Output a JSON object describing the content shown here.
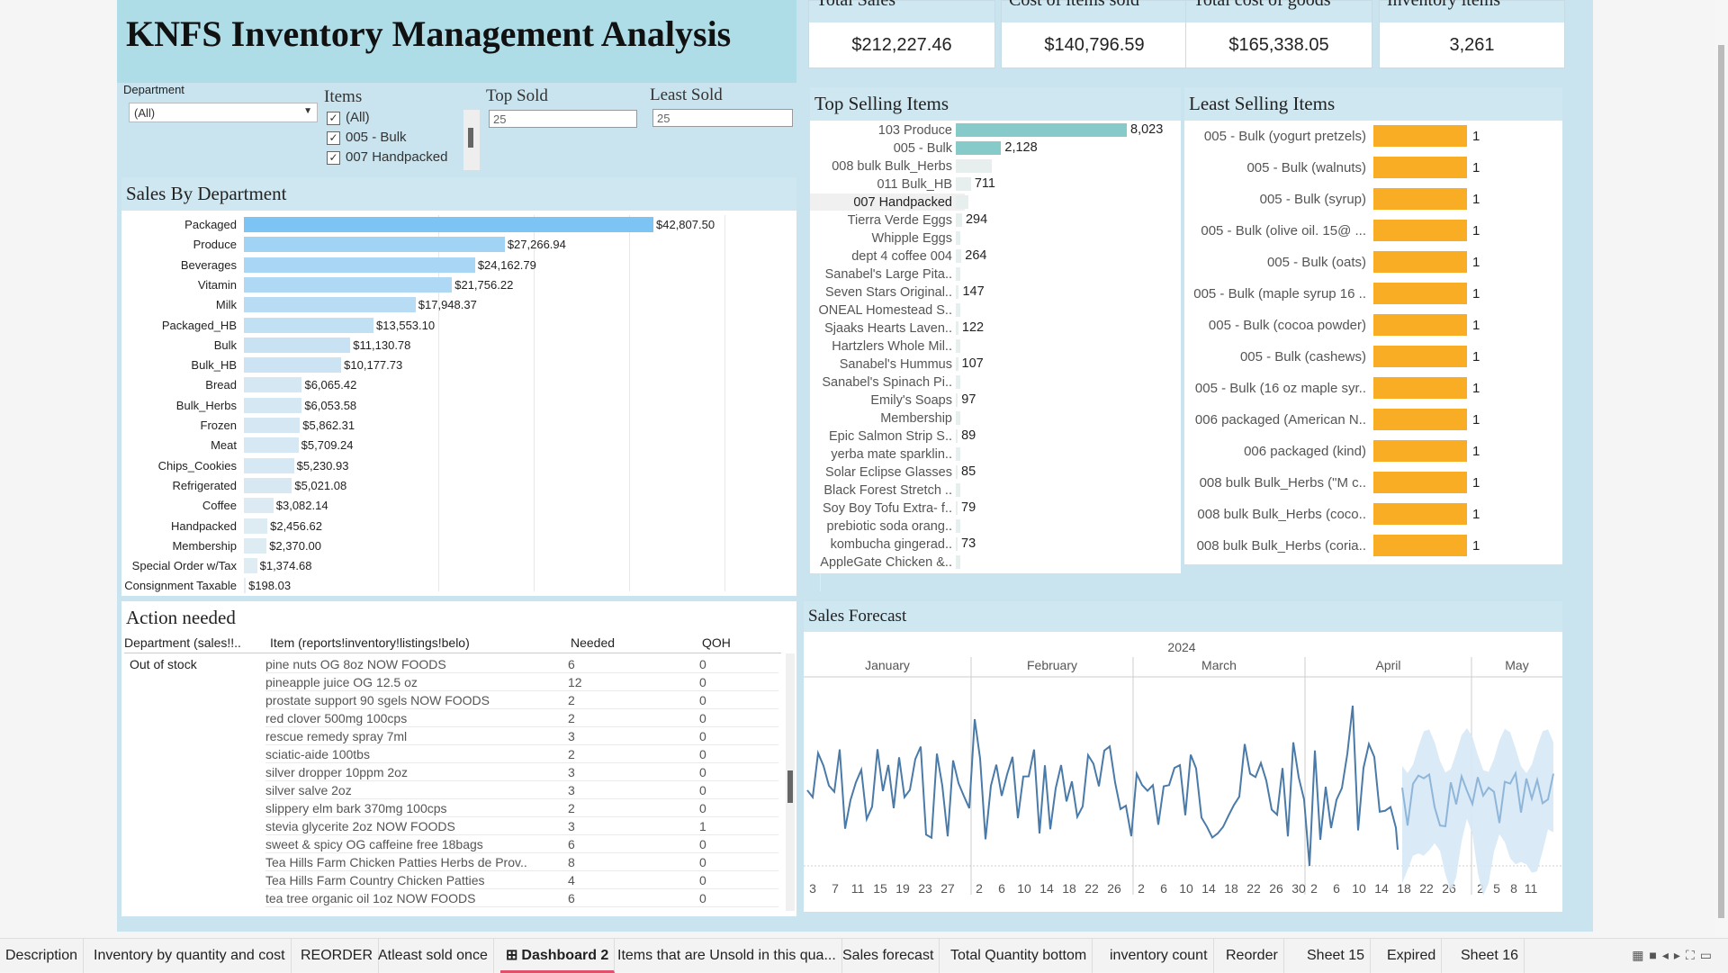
{
  "header": {
    "title": "KNFS Inventory Management Analysis"
  },
  "kpis": [
    {
      "label": "Total Sales",
      "value": "$212,227.46"
    },
    {
      "label": "Cost of items sold",
      "value": "$140,796.59"
    },
    {
      "label": "Total cost of goods",
      "value": "$165,338.05"
    },
    {
      "label": "Inventory items",
      "value": "3,261"
    }
  ],
  "filters": {
    "department_label": "Department",
    "department_value": "(All)",
    "items_label": "Items",
    "items_options": [
      "(All)",
      "005 - Bulk",
      "007 Handpacked"
    ],
    "top_sold_label": "Top Sold",
    "top_sold_value": "25",
    "least_sold_label": "Least Sold",
    "least_sold_value": "25"
  },
  "sales_by_department": {
    "title": "Sales By Department",
    "chart_data": {
      "type": "bar",
      "categories": [
        "Packaged",
        "Produce",
        "Beverages",
        "Vitamin",
        "Milk",
        "Packaged_HB",
        "Bulk",
        "Bulk_HB",
        "Bread",
        "Bulk_Herbs",
        "Frozen",
        "Meat",
        "Chips_Cookies",
        "Refrigerated",
        "Coffee",
        "Handpacked",
        "Membership",
        "Special Order w/Tax",
        "Consignment Taxable"
      ],
      "values": [
        42807.5,
        27266.94,
        24162.79,
        21756.22,
        17948.37,
        13553.1,
        11130.78,
        10177.73,
        6065.42,
        6053.58,
        5862.31,
        5709.24,
        5230.93,
        5021.08,
        3082.14,
        2456.62,
        2370.0,
        1374.68,
        198.03
      ],
      "labels": [
        "$42,807.50",
        "$27,266.94",
        "$24,162.79",
        "$21,756.22",
        "$17,948.37",
        "$13,553.10",
        "$11,130.78",
        "$10,177.73",
        "$6,065.42",
        "$6,053.58",
        "$5,862.31",
        "$5,709.24",
        "$5,230.93",
        "$5,021.08",
        "$3,082.14",
        "$2,456.62",
        "$2,370.00",
        "$1,374.68",
        "$198.03"
      ]
    }
  },
  "top_selling": {
    "title": "Top Selling Items",
    "chart_data": {
      "type": "bar",
      "categories": [
        "103 Produce",
        "005 - Bulk",
        "008 bulk Bulk_Herbs",
        "011 Bulk_HB",
        "007 Handpacked",
        "Tierra Verde Eggs",
        "Whipple Eggs",
        "dept 4 coffee 004",
        "Sanabel's Large Pita..",
        "Seven Stars Original..",
        "ONEAL Homestead S..",
        "Sjaaks  Hearts Laven..",
        "Hartzlers Whole Mil..",
        "Sanabel's Hummus",
        "Sanabel's Spinach Pi..",
        "Emily's Soaps",
        "Membership",
        "Epic Salmon Strip S..",
        "yerba mate sparklin..",
        "Solar Eclipse Glasses",
        "Black Forest Stretch ..",
        "Soy Boy Tofu Extra- f..",
        "prebiotic soda orang..",
        "kombucha gingerad..",
        "AppleGate Chicken &.."
      ],
      "values": [
        8023,
        2128,
        null,
        711,
        null,
        294,
        null,
        264,
        null,
        147,
        null,
        122,
        null,
        107,
        null,
        97,
        null,
        89,
        null,
        85,
        null,
        79,
        null,
        73,
        null
      ],
      "labels": [
        "8,023",
        "2,128",
        "",
        "711",
        "",
        "294",
        "",
        "264",
        "",
        "147",
        "",
        "122",
        "",
        "107",
        "",
        "97",
        "",
        "89",
        "",
        "85",
        "",
        "79",
        "",
        "73",
        ""
      ]
    }
  },
  "least_selling": {
    "title": "Least Selling Items",
    "chart_data": {
      "type": "bar",
      "categories": [
        "005 - Bulk (yogurt pretzels)",
        "005 - Bulk (walnuts)",
        "005 - Bulk (syrup)",
        "005 - Bulk (olive oil.  15@ ...",
        "005 - Bulk (oats)",
        "005 - Bulk (maple syrup 16 ..",
        "005 - Bulk (cocoa powder)",
        "005 - Bulk (cashews)",
        "005 - Bulk (16 oz maple syr..",
        "006 packaged (American N..",
        "006 packaged (kind)",
        "008 bulk Bulk_Herbs (\"M c..",
        "008 bulk Bulk_Herbs (coco..",
        "008 bulk Bulk_Herbs (coria.."
      ],
      "values": [
        1,
        1,
        1,
        1,
        1,
        1,
        1,
        1,
        1,
        1,
        1,
        1,
        1,
        1
      ],
      "labels": [
        "1",
        "1",
        "1",
        "1",
        "1",
        "1",
        "1",
        "1",
        "1",
        "1",
        "1",
        "1",
        "1",
        "1"
      ]
    }
  },
  "action_needed": {
    "title": "Action needed",
    "columns": [
      "Department (sales!!..",
      "Item (reports!inventory!listings!belo)",
      "Needed",
      "QOH"
    ],
    "group": "Out of stock",
    "rows": [
      [
        "pine nuts OG 8oz NOW FOODS",
        "6",
        "0"
      ],
      [
        "pineapple juice OG 12.5 oz",
        "12",
        "0"
      ],
      [
        "prostate support 90 sgels NOW FOODS",
        "2",
        "0"
      ],
      [
        "red clover 500mg 100cps",
        "2",
        "0"
      ],
      [
        "rescue remedy spray 7ml",
        "3",
        "0"
      ],
      [
        "sciatic-aide 100tbs",
        "2",
        "0"
      ],
      [
        "silver dropper 10ppm 2oz",
        "3",
        "0"
      ],
      [
        "silver salve 2oz",
        "3",
        "0"
      ],
      [
        "slippery elm bark 370mg 100cps",
        "2",
        "0"
      ],
      [
        "stevia glycerite 2oz NOW FOODS",
        "3",
        "1"
      ],
      [
        "sweet & spicy OG caffeine free 18bags",
        "6",
        "0"
      ],
      [
        "Tea Hills Farm Chicken Patties Herbs de Prov..",
        "8",
        "0"
      ],
      [
        "Tea Hills Farm Country Chicken Patties",
        "4",
        "0"
      ],
      [
        "tea tree organic oil 1oz NOW FOODS",
        "6",
        "0"
      ]
    ]
  },
  "forecast": {
    "title": "Sales Forecast",
    "year": "2024",
    "months": [
      "January",
      "February",
      "March",
      "April",
      "May"
    ],
    "days": {
      "January": [
        "3",
        "7",
        "11",
        "15",
        "19",
        "23",
        "27"
      ],
      "February": [
        "2",
        "6",
        "10",
        "14",
        "18",
        "22",
        "26"
      ],
      "March": [
        "2",
        "6",
        "10",
        "14",
        "18",
        "22",
        "26",
        "30"
      ],
      "April": [
        "2",
        "6",
        "10",
        "14",
        "18",
        "22",
        "26"
      ],
      "May": [
        "2",
        "5",
        "8",
        "11"
      ]
    }
  },
  "tabs": [
    "Description",
    "Inventory by quantity and cost",
    "REORDER",
    "Atleast sold once",
    "Dashboard 2",
    "Items that are Unsold in this qua...",
    "Sales forecast",
    "Total Quantity  bottom",
    "inventory count",
    "Reorder",
    "Sheet 15",
    "Expired",
    "Sheet 16"
  ],
  "active_tab": "Dashboard 2",
  "colors": {
    "dept_bar_max": "#7cc4f4",
    "dept_bar_min": "#e3edf3",
    "top_bar": "#86cbc9",
    "least_bar": "#f8ad25",
    "forecast_line": "#4a7aa8",
    "forecast_band": "#d6e8f5"
  }
}
